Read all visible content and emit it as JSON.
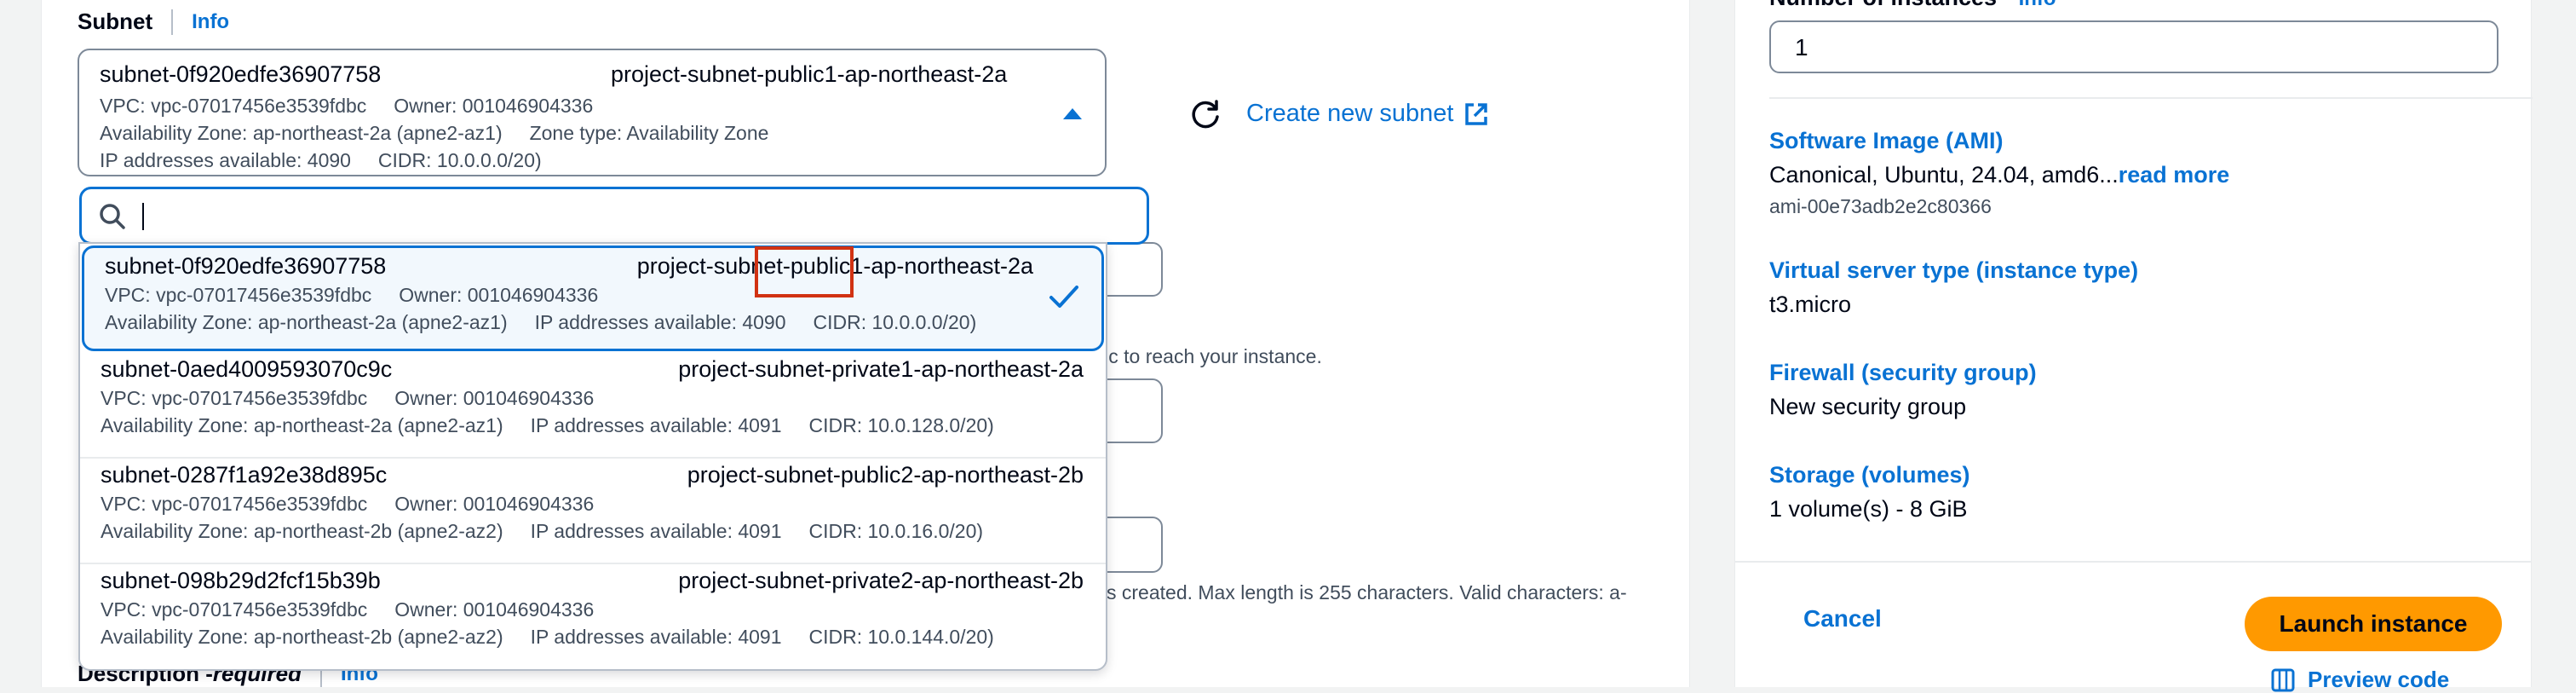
{
  "subnet": {
    "label": "Subnet",
    "info": "Info",
    "selected": {
      "id": "subnet-0f920edfe36907758",
      "name": "project-subnet-public1-ap-northeast-2a",
      "line1": "VPC: vpc-07017456e3539fdbc     Owner: 001046904336",
      "line2": "Availability Zone: ap-northeast-2a (apne2-az1)     Zone type: Availability Zone",
      "line3": "IP addresses available: 4090     CIDR: 10.0.0.0/20)"
    },
    "create_link": "Create new subnet",
    "search_placeholder": "",
    "options": [
      {
        "id": "subnet-0f920edfe36907758",
        "name": "project-subnet-public1-ap-northeast-2a",
        "line1": "VPC: vpc-07017456e3539fdbc     Owner: 001046904336",
        "line2": "Availability Zone: ap-northeast-2a (apne2-az1)     IP addresses available: 4090     CIDR: 10.0.0.0/20)"
      },
      {
        "id": "subnet-0aed4009593070c9c",
        "name": "project-subnet-private1-ap-northeast-2a",
        "line1": "VPC: vpc-07017456e3539fdbc     Owner: 001046904336",
        "line2": "Availability Zone: ap-northeast-2a (apne2-az1)     IP addresses available: 4091     CIDR: 10.0.128.0/20)"
      },
      {
        "id": "subnet-0287f1a92e38d895c",
        "name": "project-subnet-public2-ap-northeast-2b",
        "line1": "VPC: vpc-07017456e3539fdbc     Owner: 001046904336",
        "line2": "Availability Zone: ap-northeast-2b (apne2-az2)     IP addresses available: 4091     CIDR: 10.0.16.0/20)"
      },
      {
        "id": "subnet-098b29d2fcf15b39b",
        "name": "project-subnet-private2-ap-northeast-2b",
        "line1": "VPC: vpc-07017456e3539fdbc     Owner: 001046904336",
        "line2": "Availability Zone: ap-northeast-2b (apne2-az2)     IP addresses available: 4091     CIDR: 10.0.144.0/20)"
      }
    ]
  },
  "background": {
    "hint1": "affic to reach your instance.",
    "hint2": "s created. Max length is 255 characters. Valid characters: a-",
    "description_label": "Description - ",
    "description_required": "required",
    "description_info": "Info"
  },
  "summary": {
    "instances_label": "Number of instances",
    "instances_info": "Info",
    "instances_value": "1",
    "ami_title": "Software Image (AMI)",
    "ami_value": "Canonical, Ubuntu, 24.04, amd6...",
    "ami_read_more": "read more",
    "ami_id": "ami-00e73adb2e2c80366",
    "type_title": "Virtual server type (instance type)",
    "type_value": "t3.micro",
    "firewall_title": "Firewall (security group)",
    "firewall_value": "New security group",
    "storage_title": "Storage (volumes)",
    "storage_value": "1 volume(s) - 8 GiB",
    "cancel": "Cancel",
    "launch": "Launch instance",
    "preview": "Preview code"
  },
  "colors": {
    "link": "#0972d3",
    "accent": "#ff9900",
    "highlight": "#d13212"
  },
  "icons": [
    "caret-up-icon",
    "refresh-icon",
    "external-link-icon",
    "search-icon",
    "check-icon",
    "code-icon"
  ]
}
